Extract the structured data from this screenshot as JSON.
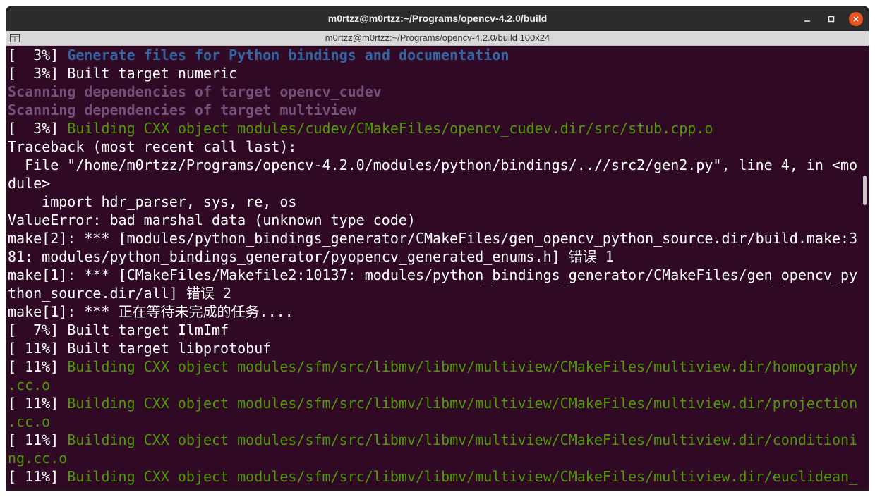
{
  "window": {
    "title": "m0rtzz@m0rtzz:~/Programs/opencv-4.2.0/build",
    "tab_title": "m0rtzz@m0rtzz:~/Programs/opencv-4.2.0/build 100x24",
    "icons": {
      "minimize": "minimize-icon",
      "maximize": "maximize-icon",
      "close": "close-icon",
      "tab_menu": "tab-menu-icon"
    }
  },
  "colors": {
    "background": "#300a24",
    "titlebar": "#2c2c2c",
    "close_button": "#e95420",
    "blue_bold": "#3465a4",
    "purple_bold": "#75507b",
    "green": "#4e9a06"
  },
  "terminal": {
    "lines": [
      {
        "prefix": "[  3%] ",
        "text": "Generate files for Python bindings and documentation",
        "style": "blue"
      },
      {
        "prefix": "",
        "text": "[  3%] Built target numeric",
        "style": "default"
      },
      {
        "prefix": "",
        "text": "Scanning dependencies of target opencv_cudev",
        "style": "purple"
      },
      {
        "prefix": "",
        "text": "Scanning dependencies of target multiview",
        "style": "purple"
      },
      {
        "prefix": "[  3%] ",
        "text": "Building CXX object modules/cudev/CMakeFiles/opencv_cudev.dir/src/stub.cpp.o",
        "style": "green"
      },
      {
        "prefix": "",
        "text": "Traceback (most recent call last):",
        "style": "default"
      },
      {
        "prefix": "",
        "text": "  File \"/home/m0rtzz/Programs/opencv-4.2.0/modules/python/bindings/..//src2/gen2.py\", line 4, in <mo",
        "style": "default"
      },
      {
        "prefix": "",
        "text": "dule>",
        "style": "default"
      },
      {
        "prefix": "",
        "text": "    import hdr_parser, sys, re, os",
        "style": "default"
      },
      {
        "prefix": "",
        "text": "ValueError: bad marshal data (unknown type code)",
        "style": "default"
      },
      {
        "prefix": "",
        "text": "make[2]: *** [modules/python_bindings_generator/CMakeFiles/gen_opencv_python_source.dir/build.make:3",
        "style": "default"
      },
      {
        "prefix": "",
        "text": "81: modules/python_bindings_generator/pyopencv_generated_enums.h] 错误 1",
        "style": "default"
      },
      {
        "prefix": "",
        "text": "make[1]: *** [CMakeFiles/Makefile2:10137: modules/python_bindings_generator/CMakeFiles/gen_opencv_py",
        "style": "default"
      },
      {
        "prefix": "",
        "text": "thon_source.dir/all] 错误 2",
        "style": "default"
      },
      {
        "prefix": "",
        "text": "make[1]: *** 正在等待未完成的任务....",
        "style": "default"
      },
      {
        "prefix": "",
        "text": "[  7%] Built target IlmImf",
        "style": "default"
      },
      {
        "prefix": "",
        "text": "[ 11%] Built target libprotobuf",
        "style": "default"
      },
      {
        "prefix": "[ 11%] ",
        "text": "Building CXX object modules/sfm/src/libmv/libmv/multiview/CMakeFiles/multiview.dir/homography",
        "style": "green"
      },
      {
        "prefix": "",
        "text": ".cc.o",
        "style": "green"
      },
      {
        "prefix": "[ 11%] ",
        "text": "Building CXX object modules/sfm/src/libmv/libmv/multiview/CMakeFiles/multiview.dir/projection",
        "style": "green"
      },
      {
        "prefix": "",
        "text": ".cc.o",
        "style": "green"
      },
      {
        "prefix": "[ 11%] ",
        "text": "Building CXX object modules/sfm/src/libmv/libmv/multiview/CMakeFiles/multiview.dir/conditioni",
        "style": "green"
      },
      {
        "prefix": "",
        "text": "ng.cc.o",
        "style": "green"
      },
      {
        "prefix": "[ 11%] ",
        "text": "Building CXX object modules/sfm/src/libmv/libmv/multiview/CMakeFiles/multiview.dir/euclidean_",
        "style": "green"
      }
    ]
  }
}
